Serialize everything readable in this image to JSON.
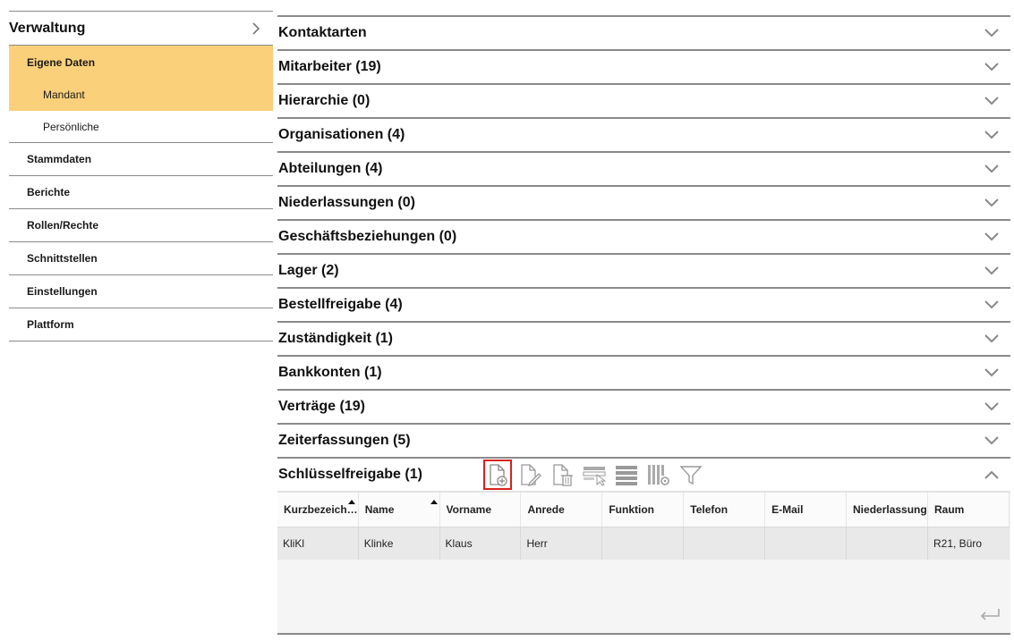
{
  "sidebar": {
    "title": "Verwaltung",
    "items": [
      {
        "label": "Eigene Daten"
      },
      {
        "label": "Mandant"
      },
      {
        "label": "Persönliche"
      },
      {
        "label": "Stammdaten"
      },
      {
        "label": "Berichte"
      },
      {
        "label": "Rollen/Rechte"
      },
      {
        "label": "Schnittstellen"
      },
      {
        "label": "Einstellungen"
      },
      {
        "label": "Plattform"
      }
    ]
  },
  "accordion": {
    "rows": [
      {
        "label": "Kontaktarten"
      },
      {
        "label": "Mitarbeiter (19)"
      },
      {
        "label": "Hierarchie (0)"
      },
      {
        "label": "Organisationen (4)"
      },
      {
        "label": "Abteilungen (4)"
      },
      {
        "label": "Niederlassungen (0)"
      },
      {
        "label": "Geschäftsbeziehungen (0)"
      },
      {
        "label": "Lager (2)"
      },
      {
        "label": "Bestellfreigabe (4)"
      },
      {
        "label": "Zuständigkeit (1)"
      },
      {
        "label": "Bankkonten (1)"
      },
      {
        "label": "Verträge (19)"
      },
      {
        "label": "Zeiterfassungen (5)"
      }
    ],
    "open_section": {
      "label": "Schlüsselfreigabe (1)",
      "toolbar": [
        "new-document-icon",
        "edit-document-icon",
        "delete-document-icon",
        "select-row-icon",
        "rows-icon",
        "column-settings-icon",
        "filter-icon"
      ]
    }
  },
  "table": {
    "columns": [
      "Kurzbezeich…",
      "Name",
      "Vorname",
      "Anrede",
      "Funktion",
      "Telefon",
      "E-Mail",
      "Niederlassung",
      "Raum"
    ],
    "rows": [
      [
        "KliKl",
        "Klinke",
        "Klaus",
        "Herr",
        "",
        "",
        "",
        "",
        "R21, Büro"
      ]
    ]
  },
  "colors": {
    "active_bg": "#fbd07a",
    "selected_border": "#d9221c"
  }
}
